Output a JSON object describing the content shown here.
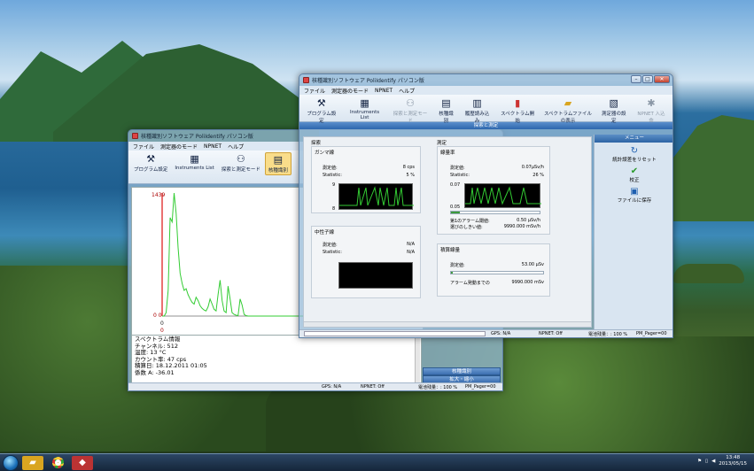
{
  "main_window": {
    "title": "核種識別ソフトウェア PoliIdentify パソコン版",
    "menu": [
      "ファイル",
      "測定器のモード",
      "NPNET",
      "ヘルプ"
    ],
    "toolbar": [
      {
        "label": "プログラム設定",
        "icon": "tools-icon",
        "enabled": true
      },
      {
        "label": "Instruments List",
        "icon": "devices-icon",
        "enabled": true
      },
      {
        "label": "探索と測定モード",
        "icon": "binoculars-icon",
        "enabled": false
      },
      {
        "label": "核種識別",
        "icon": "id-card-icon",
        "enabled": true
      },
      {
        "label": "履歴読み込み",
        "icon": "history-icon",
        "enabled": true
      },
      {
        "label": "スペクトラム開始",
        "icon": "bar-chart-icon",
        "enabled": true
      },
      {
        "label": "スペクトラムファイルの表示",
        "icon": "folder-icon",
        "enabled": true
      },
      {
        "label": "測定器の設定",
        "icon": "clipboard-icon",
        "enabled": true
      },
      {
        "label": "NPNET 入込命",
        "icon": "network-icon",
        "enabled": false
      }
    ],
    "section_header": "探索と測定",
    "search": {
      "title": "探索",
      "gamma": {
        "title": "ガンマ線",
        "measured_label": "測定値:",
        "measured_value": "8 cps",
        "stat_label": "Statistic:",
        "stat_value": "5 %",
        "axis_top": "9",
        "axis_bottom": "8"
      },
      "neutron": {
        "title": "中性子線",
        "measured_label": "測定値:",
        "measured_value": "N/A",
        "stat_label": "Statistic:",
        "stat_value": "N/A"
      }
    },
    "measure": {
      "title": "測定",
      "dose_rate": {
        "title": "線量率",
        "measured_label": "測定値:",
        "measured_value": "0.07μSv/h",
        "stat_label": "Statistic:",
        "stat_value": "26 %",
        "axis_top": "0.07",
        "axis_bottom": "0.05",
        "alarm1_label": "第1のアラーム閾値:",
        "alarm1_value": "0.50 μSv/h",
        "threshold_label": "選びのしきい値:",
        "threshold_value": "9990.000 mSv/h",
        "bar_level": 0.1
      },
      "accumulated": {
        "title": "積算線量",
        "measured_label": "測定値:",
        "measured_value": "53.00 μSv",
        "alarm_label": "アラーム発動までの",
        "alarm_value": "9990.000 mSv",
        "bar_level": 0.02
      }
    },
    "side_menu": {
      "title": "メニュー",
      "items": [
        {
          "label": "統計誤差をリセット",
          "icon": "refresh-icon"
        },
        {
          "label": "校正",
          "icon": "check-icon"
        },
        {
          "label": "ファイルに保存",
          "icon": "save-icon"
        }
      ]
    },
    "status": {
      "gps": "GPS: N/A",
      "npnet": "NPNET: Off",
      "battery": "電池残量：: 100 %",
      "pager": "PM_Pager=00"
    }
  },
  "back_window": {
    "title": "核種識別ソフトウェア PoliIdentify パソコン版",
    "menu": [
      "ファイル",
      "測定器のモード",
      "NPNET",
      "ヘルプ"
    ],
    "toolbar": [
      {
        "label": "プログラム設定",
        "icon": "tools-icon"
      },
      {
        "label": "Instruments List",
        "icon": "devices-icon"
      },
      {
        "label": "探索と測定モード",
        "icon": "binoculars-icon"
      },
      {
        "label": "核種識別",
        "icon": "id-card-icon"
      }
    ],
    "spectrum": {
      "y_top_label": "1439",
      "y_bottom_label": "0 0",
      "x_start_label": "0",
      "x_sub_label": "0"
    },
    "info_lines": [
      "スペクトラム情報",
      "チャンネル: 512",
      "温度: 13 °C",
      "カウント率: 47 cps",
      "積算日: 18.12.2011 01:05",
      "係数 A: -36.01"
    ],
    "side_buttons": [
      "核種識別",
      "拡大・縮小"
    ],
    "status": {
      "gps": "GPS: N/A",
      "npnet": "NPNET: Off",
      "battery": "電池残量：: 100 %",
      "pager": "PM_Pager=00"
    }
  },
  "taskbar": {
    "apps": [
      "folder-icon",
      "chrome-icon",
      "poliidentify-icon"
    ],
    "time": "13:48",
    "date": "2013/05/15"
  },
  "chart_data": {
    "type": "line",
    "series": [
      {
        "values": [
          0,
          0,
          40,
          300,
          1150,
          1100,
          1439,
          1200,
          800,
          500,
          380,
          300,
          320,
          250,
          200,
          160,
          140,
          220,
          180,
          120,
          90,
          70,
          60,
          110,
          200,
          140,
          80,
          60,
          250,
          420,
          180,
          60,
          40,
          350,
          200,
          40,
          20,
          10,
          5,
          200,
          130,
          20,
          5,
          0,
          0,
          0,
          0,
          0
        ]
      }
    ],
    "ylim": [
      0,
      1439
    ],
    "color": "#33cc33"
  }
}
